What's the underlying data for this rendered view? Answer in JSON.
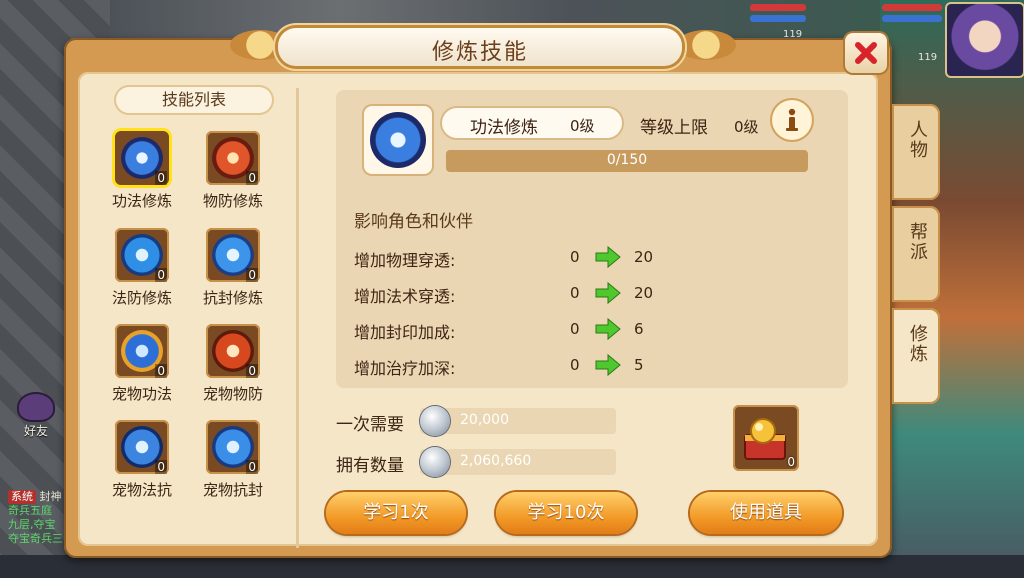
{
  "dialog": {
    "title": "修炼技能"
  },
  "skill_list": {
    "title": "技能列表",
    "items": [
      {
        "label": "功法修炼",
        "count": "0",
        "selected": true
      },
      {
        "label": "物防修炼",
        "count": "0"
      },
      {
        "label": "法防修炼",
        "count": "0"
      },
      {
        "label": "抗封修炼",
        "count": "0"
      },
      {
        "label": "宠物功法",
        "count": "0"
      },
      {
        "label": "宠物物防",
        "count": "0"
      },
      {
        "label": "宠物法抗",
        "count": "0"
      },
      {
        "label": "宠物抗封",
        "count": "0"
      }
    ]
  },
  "detail": {
    "name": "功法修炼",
    "level": "0级",
    "cap_label": "等级上限",
    "cap_level": "0级",
    "progress_text": "0/150",
    "progress_fraction": 0,
    "affect_title": "影响角色和伙伴",
    "stats": [
      {
        "label": "增加物理穿透:",
        "from": "0",
        "to": "20"
      },
      {
        "label": "增加法术穿透:",
        "from": "0",
        "to": "20"
      },
      {
        "label": "增加封印加成:",
        "from": "0",
        "to": "6"
      },
      {
        "label": "增加治疗加深:",
        "from": "0",
        "to": "5"
      }
    ]
  },
  "cost": {
    "need_label": "一次需要",
    "need_value": "20,000",
    "have_label": "拥有数量",
    "have_value": "2,060,660"
  },
  "item_slot": {
    "count": "0"
  },
  "buttons": {
    "learn_once": "学习1次",
    "learn_ten": "学习10次",
    "use_item": "使用道具"
  },
  "tabs": [
    {
      "label": "人物"
    },
    {
      "label": "帮派"
    },
    {
      "label": "修炼",
      "active": true
    }
  ],
  "hud": {
    "level_1": "119",
    "level_2": "119",
    "friend_label": "好友",
    "chat_sys": "系统",
    "chat_lines": [
      "封神",
      "奇兵五庭",
      "九层,夺宝",
      "夺宝奇兵三"
    ]
  },
  "colors": {
    "accent": "#f29a28",
    "selected_border": "#ffe21a",
    "arrow": "#4fc72e",
    "close": "#d8232a"
  }
}
